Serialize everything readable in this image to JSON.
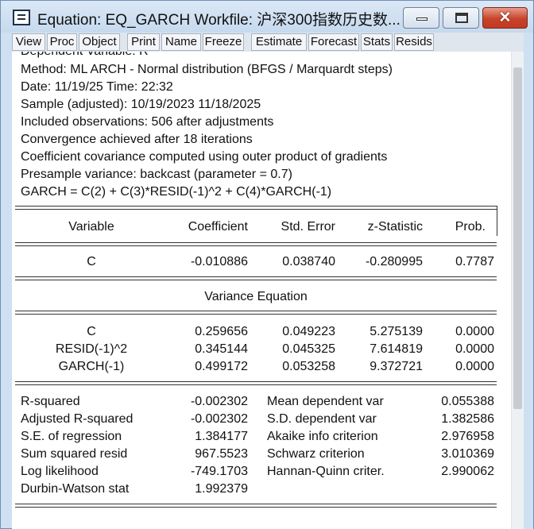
{
  "window": {
    "title": "Equation: EQ_GARCH   Workfile: 沪深300指数历史数...",
    "close_symbol": "✕"
  },
  "toolbar": {
    "buttons": [
      "View",
      "Proc",
      "Object",
      "Print",
      "Name",
      "Freeze",
      "Estimate",
      "Forecast",
      "Stats",
      "Resids"
    ]
  },
  "header": {
    "line0": "Dependent Variable: R",
    "line1": "Method: ML ARCH - Normal distribution (BFGS / Marquardt steps)",
    "line2": "Date: 11/19/25   Time: 22:32",
    "line3": "Sample (adjusted): 10/19/2023 11/18/2025",
    "line4": "Included observations: 506 after adjustments",
    "line5": "Convergence achieved after 18 iterations",
    "line6": "Coefficient covariance computed using outer product of gradients",
    "line7": "Presample variance: backcast (parameter = 0.7)",
    "line8": "GARCH = C(2) + C(3)*RESID(-1)^2 + C(4)*GARCH(-1)"
  },
  "coef_table": {
    "headers": [
      "Variable",
      "Coefficient",
      "Std. Error",
      "z-Statistic",
      "Prob."
    ],
    "mean_rows": [
      [
        "C",
        "-0.010886",
        "0.038740",
        "-0.280995",
        "0.7787"
      ]
    ],
    "variance_title": "Variance Equation",
    "variance_rows": [
      [
        "C",
        "0.259656",
        "0.049223",
        "5.275139",
        "0.0000"
      ],
      [
        "RESID(-1)^2",
        "0.345144",
        "0.045325",
        "7.614819",
        "0.0000"
      ],
      [
        "GARCH(-1)",
        "0.499172",
        "0.053258",
        "9.372721",
        "0.0000"
      ]
    ]
  },
  "stats": {
    "left": [
      [
        "R-squared",
        "-0.002302"
      ],
      [
        "Adjusted R-squared",
        "-0.002302"
      ],
      [
        "S.E. of regression",
        "1.384177"
      ],
      [
        "Sum squared resid",
        "967.5523"
      ],
      [
        "Log likelihood",
        "-749.1703"
      ],
      [
        "Durbin-Watson stat",
        "1.992379"
      ]
    ],
    "right": [
      [
        "Mean dependent var",
        "0.055388"
      ],
      [
        "S.D. dependent var",
        "1.382586"
      ],
      [
        "Akaike info criterion",
        "2.976958"
      ],
      [
        "Schwarz criterion",
        "3.010369"
      ],
      [
        "Hannan-Quinn criter.",
        "2.990062"
      ]
    ]
  }
}
